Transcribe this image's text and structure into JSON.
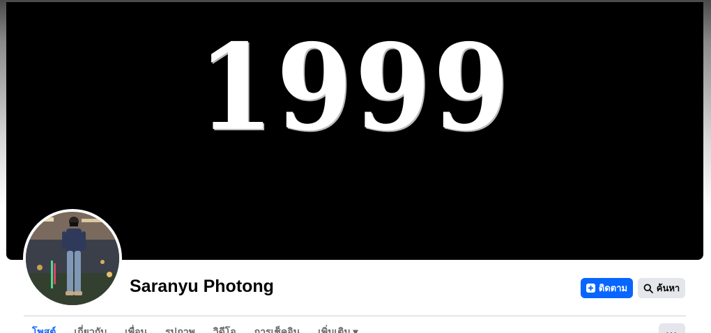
{
  "cover": {
    "text": "1999"
  },
  "profile": {
    "name": "Saranyu Photong"
  },
  "actions": {
    "follow_label": "ติดตาม",
    "search_label": "ค้นหา"
  },
  "tabs": [
    {
      "label": "โพสต์",
      "active": true
    },
    {
      "label": "เกี่ยวกับ"
    },
    {
      "label": "เพื่อน"
    },
    {
      "label": "รูปภาพ"
    },
    {
      "label": "วิดีโอ"
    },
    {
      "label": "การเช็คอิน"
    },
    {
      "label": "เพิ่มเติม ▾"
    }
  ],
  "more": {
    "label": "···"
  },
  "colors": {
    "primary": "#0866ff",
    "secondary_button": "#e4e6eb",
    "cover_bg": "#000000"
  },
  "icons": {
    "follow": "follow-plus-icon",
    "search": "search-icon"
  }
}
